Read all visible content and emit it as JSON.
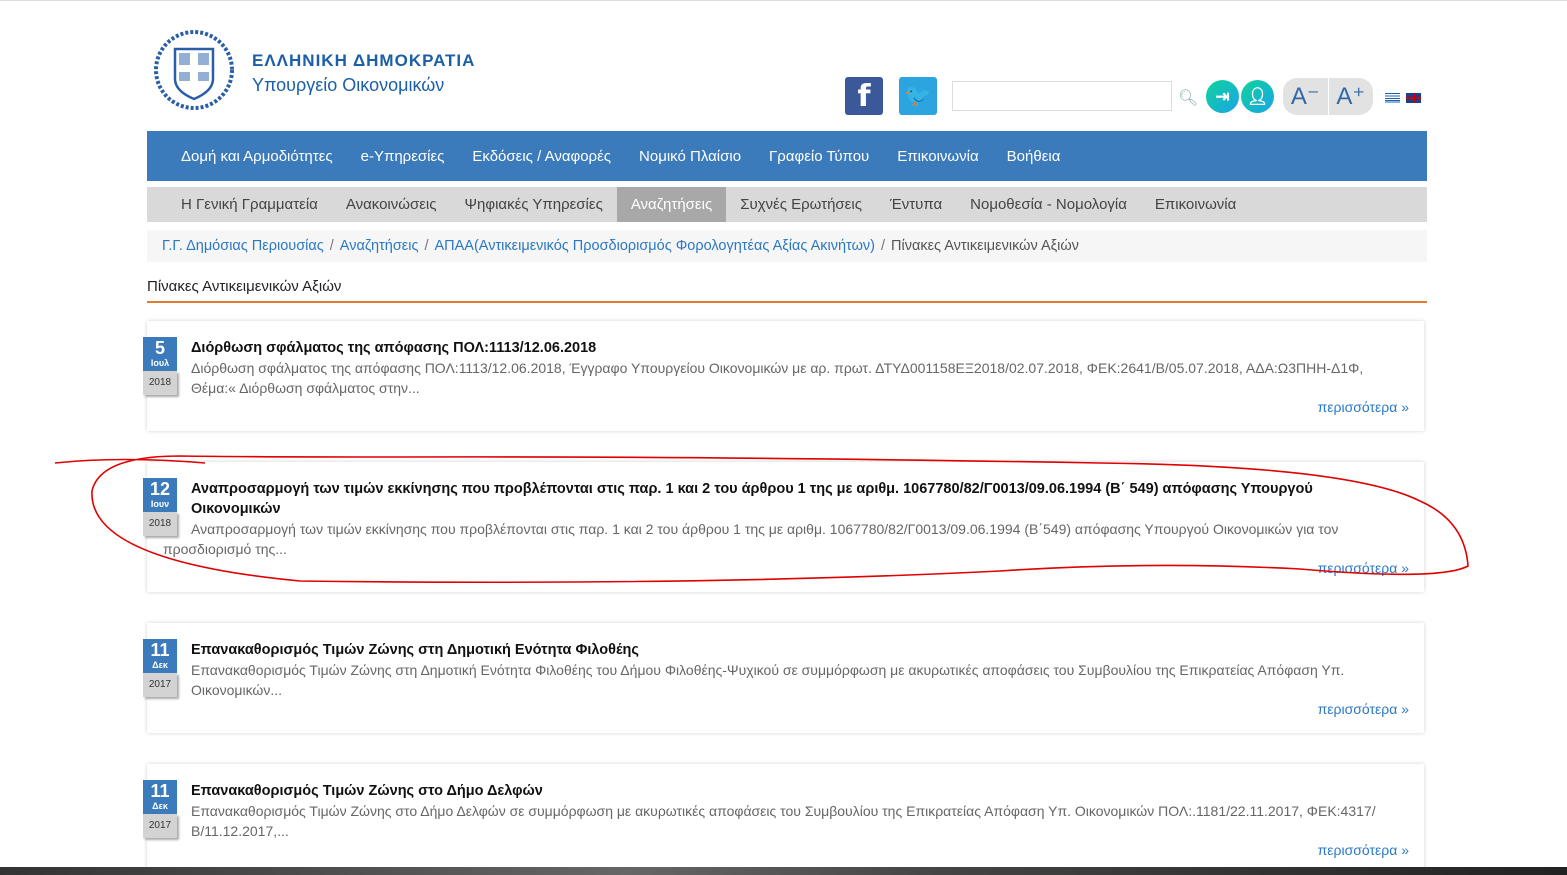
{
  "header": {
    "brand_line1": "ΕΛΛΗΝΙΚΗ ΔΗΜΟΚΡΑΤΙΑ",
    "brand_line2": "Υπουργείο Οικονομικών",
    "search": {
      "value": "",
      "placeholder": ""
    },
    "font_decrease": "A⁻",
    "font_increase": "A⁺",
    "icons": [
      "facebook-icon",
      "twitter-icon",
      "search-icon",
      "login-icon",
      "register-icon",
      "greek-flag-icon",
      "uk-flag-icon"
    ]
  },
  "nav_main": [
    "Δομή και Αρμοδιότητες",
    "e-Υπηρεσίες",
    "Εκδόσεις / Αναφορές",
    "Νομικό Πλαίσιο",
    "Γραφείο Τύπου",
    "Επικοινωνία",
    "Βοήθεια"
  ],
  "nav_sub": {
    "items": [
      "Η Γενική Γραμματεία",
      "Ανακοινώσεις",
      "Ψηφιακές Υπηρεσίες",
      "Αναζητήσεις",
      "Συχνές Ερωτήσεις",
      "Έντυπα",
      "Νομοθεσία - Νομολογία",
      "Επικοινωνία"
    ],
    "active": "Αναζητήσεις"
  },
  "breadcrumb": [
    "Γ.Γ. Δημόσιας Περιουσίας",
    "Αναζητήσεις",
    "ΑΠΑΑ(Αντικειμενικός Προσδιορισμός Φορολογητέας Αξίας Ακινήτων)",
    "Πίνακες Αντικειμενικών Αξιών"
  ],
  "page_title": "Πίνακες Αντικειμενικών Αξιών",
  "colors": {
    "nav": "#3b7bbb",
    "accent_line": "#e07a2c",
    "link": "#2a78c5",
    "annotation": "#e00000"
  },
  "articles": [
    {
      "day": "5",
      "month": "Ιουλ",
      "year": "2018",
      "title": "Διόρθωση σφάλματος της απόφασης ΠΟΛ:1113/12.06.2018",
      "desc": "Διόρθωση σφάλματος της απόφασης ΠΟΛ:1113/12.06.2018, Έγγραφο Υπουργείου Οικονομικών με αρ. πρωτ. ΔΤΥΔ001158ΕΞ2018/02.07.2018, ΦΕΚ:2641/Β/05.07.2018, ΑΔΑ:Ω3ΠΗΗ-Δ1Φ, Θέμα:« Διόρθωση σφάλματος στην...",
      "more": "περισσότερα »"
    },
    {
      "day": "12",
      "month": "Ιουν",
      "year": "2018",
      "title": "Αναπροσαρμογή των τιμών εκκίνησης που προβλέπονται στις παρ. 1 και 2 του άρθρου 1 της με αριθμ. 1067780/82/Γ0013/09.06.1994 (Β΄ 549) απόφασης Υπουργού Οικονομικών",
      "desc": "Αναπροσαρμογή των τιμών εκκίνησης που προβλέπονται στις παρ. 1 και 2 του άρθρου 1 της με αριθμ. 1067780/82/Γ0013/09.06.1994 (Β΄549) απόφασης Υπουργού Οικονομικών για τον προσδιορισμό της...",
      "more": "περισσότερα »"
    },
    {
      "day": "11",
      "month": "Δεκ",
      "year": "2017",
      "title": "Επανακαθορισμός Τιμών Ζώνης στη Δημοτική Ενότητα Φιλοθέης",
      "desc": "Επανακαθορισμός Τιμών Ζώνης στη Δημοτική Ενότητα Φιλοθέης του Δήμου Φιλοθέης-Ψυχικού σε συμμόρφωση με ακυρωτικές αποφάσεις του Συμβουλίου της Επικρατείας Απόφαση Υπ. Οικονομικών...",
      "more": "περισσότερα »"
    },
    {
      "day": "11",
      "month": "Δεκ",
      "year": "2017",
      "title": "Επανακαθορισμός Τιμών Ζώνης στο Δήμο Δελφών",
      "desc": "Επανακαθορισμός Τιμών Ζώνης στο Δήμο Δελφών σε συμμόρφωση με ακυρωτικές αποφάσεις του Συμβουλίου της Επικρατείας Απόφαση Υπ. Οικονομικών ΠΟΛ:.1181/22.11.2017, ΦΕΚ:4317/Β/11.12.2017,...",
      "more": "περισσότερα »"
    }
  ]
}
